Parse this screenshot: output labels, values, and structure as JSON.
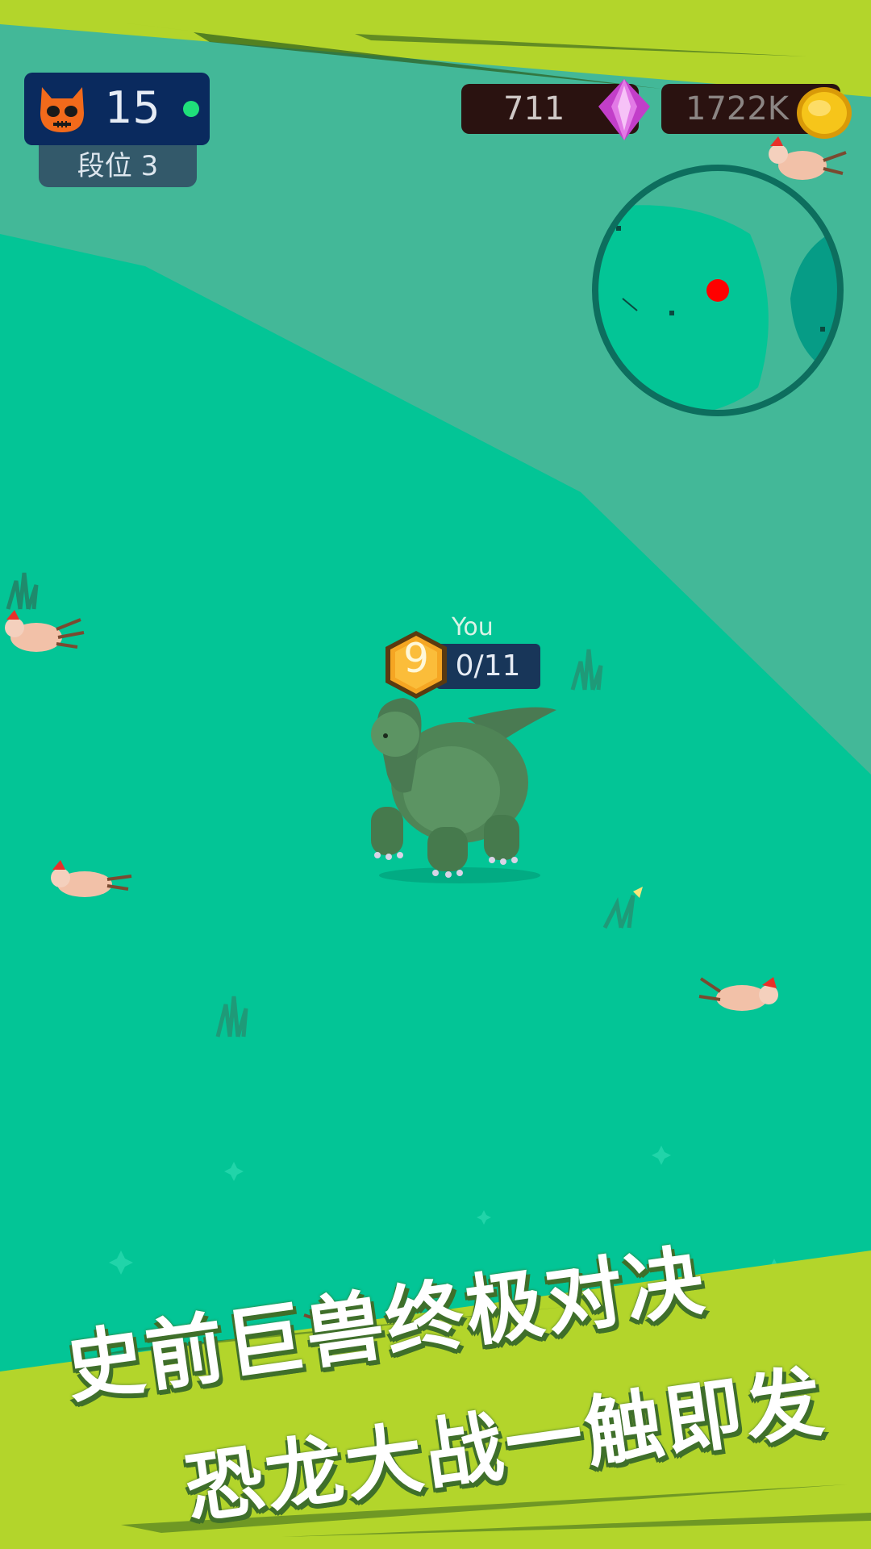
{
  "hud": {
    "kill_count": "15",
    "rank_label": "段位 3",
    "gems": "711",
    "coins": "1722K"
  },
  "player": {
    "name": "You",
    "level": "9",
    "progress": "0/11"
  },
  "banner": {
    "line1": "史前巨兽终极对决",
    "line2": "恐龙大战一触即发"
  },
  "colors": {
    "ground": "#03c596",
    "ground_light": "#43b898",
    "banner_green": "#b3d52b",
    "player_marker": "#ff0000"
  }
}
